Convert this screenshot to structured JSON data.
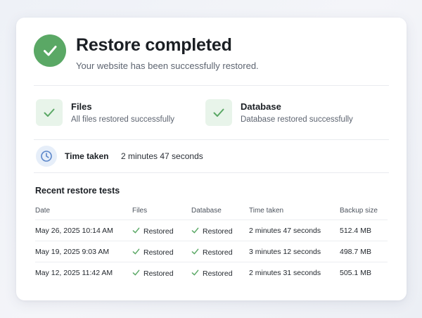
{
  "header": {
    "title": "Restore completed",
    "subtitle": "Your website has been successfully restored."
  },
  "status": {
    "files": {
      "title": "Files",
      "subtitle": "All files restored successfully"
    },
    "database": {
      "title": "Database",
      "subtitle": "Database restored successfully"
    }
  },
  "time_taken": {
    "label": "Time taken",
    "value": "2 minutes 47 seconds"
  },
  "recent": {
    "title": "Recent restore tests",
    "columns": [
      "Date",
      "Files",
      "Database",
      "Time taken",
      "Backup size"
    ],
    "rows": [
      {
        "date": "May 26, 2025 10:14 AM",
        "files": "Restored",
        "database": "Restored",
        "time": "2 minutes 47 seconds",
        "size": "512.4 MB"
      },
      {
        "date": "May 19, 2025 9:03 AM",
        "files": "Restored",
        "database": "Restored",
        "time": "3 minutes 12 seconds",
        "size": "498.7 MB"
      },
      {
        "date": "May 12, 2025 11:42 AM",
        "files": "Restored",
        "database": "Restored",
        "time": "2 minutes 31 seconds",
        "size": "505.1 MB"
      }
    ]
  },
  "colors": {
    "success": "#5aa865",
    "success_tile": "#e8f4ea",
    "clock_bg": "#e6eef9",
    "clock": "#5b86c9"
  },
  "icons": {
    "header": "check-circle-icon",
    "status": "check-icon",
    "time": "clock-icon",
    "row": "check-icon"
  }
}
